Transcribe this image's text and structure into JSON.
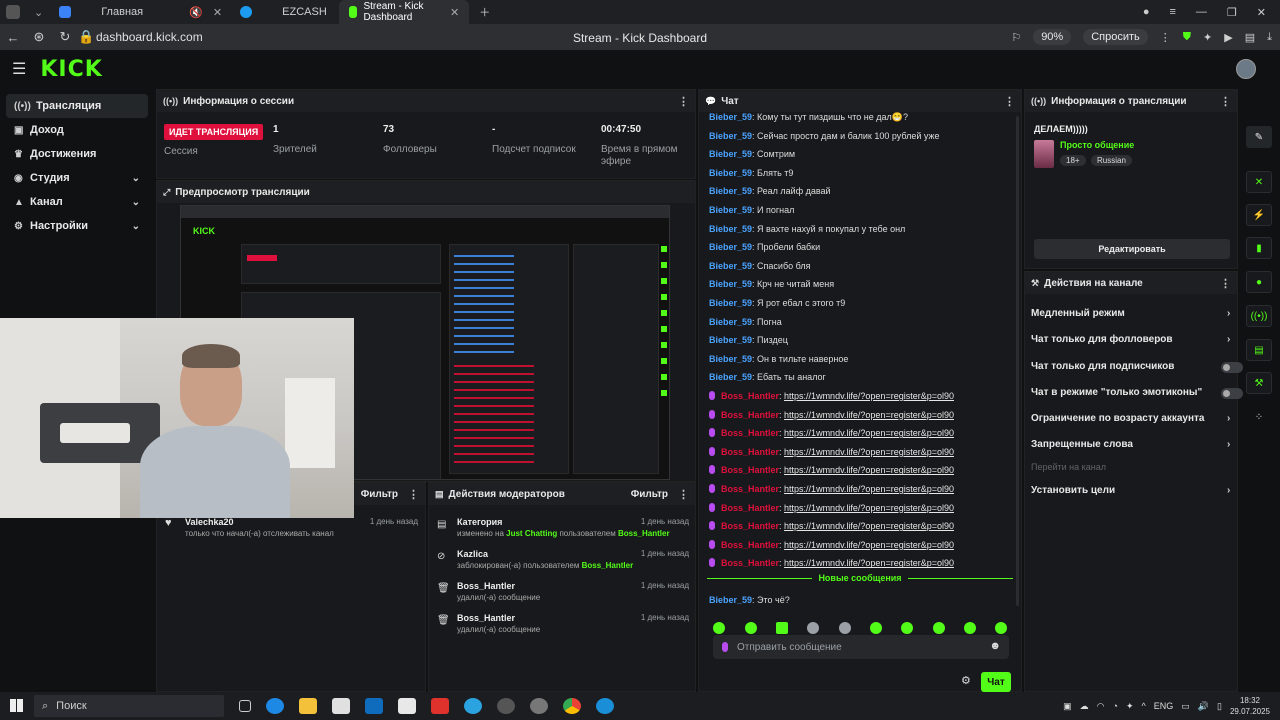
{
  "browser": {
    "tabs": [
      {
        "label": "Главная",
        "color": "#3b82f6"
      },
      {
        "label": "EZCASH",
        "color": "#1d9bf0"
      },
      {
        "label": "Stream - Kick Dashboard",
        "color": "#53fc18"
      }
    ],
    "url": "dashboard.kick.com",
    "page_title": "Stream - Kick Dashboard",
    "zoom": "90%",
    "ask_label": "Спросить"
  },
  "kick": {
    "logo": "KICK",
    "sidebar": [
      {
        "label": "Трансляция",
        "icon": "broadcast-icon",
        "chev": false
      },
      {
        "label": "Доход",
        "icon": "wallet-icon",
        "chev": false
      },
      {
        "label": "Достижения",
        "icon": "trophy-icon",
        "chev": false
      },
      {
        "label": "Студия",
        "icon": "studio-icon",
        "chev": true
      },
      {
        "label": "Канал",
        "icon": "channel-icon",
        "chev": true
      },
      {
        "label": "Настройки",
        "icon": "gear-icon",
        "chev": true
      }
    ]
  },
  "session": {
    "title": "Информация о сессии",
    "live_badge": "ИДЕТ ТРАНСЛЯЦИЯ",
    "live_label": "Сессия",
    "viewers": "1",
    "viewers_label": "Зрителей",
    "followers": "73",
    "followers_label": "Фолловеры",
    "subs": "-",
    "subs_label": "Подсчет подписок",
    "uptime": "00:47:50",
    "uptime_label": "Время в прямом эфире"
  },
  "preview": {
    "title": "Предпросмотр трансляции"
  },
  "activity": {
    "filter_label": "Фильтр",
    "item_user": "Valechka20",
    "item_text": "только что начал(-а) отслеживать канал",
    "item_time": "1 день назад"
  },
  "mod_actions": {
    "title": "Действия модераторов",
    "filter_label": "Фильтр",
    "items": [
      {
        "title": "Категория",
        "pre": "изменено на ",
        "hl": "Just Chatting",
        "mid": " пользователем ",
        "hl2": "Boss_Hantler",
        "time": "1 день назад",
        "icon": "list-icon"
      },
      {
        "title": "Kazlica",
        "pre": "заблокирован(-а) пользователем ",
        "hl": "Boss_Hantler",
        "mid": "",
        "hl2": "",
        "time": "1 день назад",
        "icon": "ban-icon"
      },
      {
        "title": "Boss_Hantler",
        "pre": "удалил(-а) сообщение",
        "hl": "",
        "mid": "",
        "hl2": "",
        "time": "1 день назад",
        "icon": "trash-icon"
      },
      {
        "title": "Boss_Hantler",
        "pre": "удалил(-а) сообщение",
        "hl": "",
        "mid": "",
        "hl2": "",
        "time": "1 день назад",
        "icon": "trash-icon"
      }
    ]
  },
  "chat": {
    "title": "Чат",
    "messages": [
      {
        "user": "Bieber_59",
        "text": "Кому ты тут пиздишь что не дал😁?",
        "spam": false
      },
      {
        "user": "Bieber_59",
        "text": "Сейчас просто дам и балик 100 рублей уже",
        "spam": false
      },
      {
        "user": "Bieber_59",
        "text": "Сомтрим",
        "spam": false
      },
      {
        "user": "Bieber_59",
        "text": "Блять т9",
        "spam": false
      },
      {
        "user": "Bieber_59",
        "text": "Реал лайф давай",
        "spam": false
      },
      {
        "user": "Bieber_59",
        "text": "И погнал",
        "spam": false
      },
      {
        "user": "Bieber_59",
        "text": "Я вахте нахуй я покупал у тебе онл",
        "spam": false
      },
      {
        "user": "Bieber_59",
        "text": "Пробели бабки",
        "spam": false
      },
      {
        "user": "Bieber_59",
        "text": "Спасибо бля",
        "spam": false
      },
      {
        "user": "Bieber_59",
        "text": "Крч не читай меня",
        "spam": false
      },
      {
        "user": "Bieber_59",
        "text": "Я рот ебал с этого т9",
        "spam": false
      },
      {
        "user": "Bieber_59",
        "text": "Погна",
        "spam": false
      },
      {
        "user": "Bieber_59",
        "text": "Пиздец",
        "spam": false
      },
      {
        "user": "Bieber_59",
        "text": "Он в тильте наверное",
        "spam": false
      },
      {
        "user": "Bieber_59",
        "text": "Ебать ты аналог",
        "spam": false
      },
      {
        "user": "Boss_Hantler",
        "text": "https://1wmndv.life/?open=register&p=ol90",
        "spam": true
      },
      {
        "user": "Boss_Hantler",
        "text": "https://1wmndv.life/?open=register&p=ol90",
        "spam": true
      },
      {
        "user": "Boss_Hantler",
        "text": "https://1wmndv.life/?open=register&p=ol90",
        "spam": true
      },
      {
        "user": "Boss_Hantler",
        "text": "https://1wmndv.life/?open=register&p=ol90",
        "spam": true
      },
      {
        "user": "Boss_Hantler",
        "text": "https://1wmndv.life/?open=register&p=ol90",
        "spam": true
      },
      {
        "user": "Boss_Hantler",
        "text": "https://1wmndv.life/?open=register&p=ol90",
        "spam": true
      },
      {
        "user": "Boss_Hantler",
        "text": "https://1wmndv.life/?open=register&p=ol90",
        "spam": true
      },
      {
        "user": "Boss_Hantler",
        "text": "https://1wmndv.life/?open=register&p=ol90",
        "spam": true
      },
      {
        "user": "Boss_Hantler",
        "text": "https://1wmndv.life/?open=register&p=ol90",
        "spam": true
      },
      {
        "user": "Boss_Hantler",
        "text": "https://1wmndv.life/?open=register&p=ol90",
        "spam": true
      }
    ],
    "new_messages": "Новые сообщения",
    "last_user": "Bieber_59",
    "last_text": "Это чё?",
    "placeholder": "Отправить сообщение",
    "send_label": "Чат"
  },
  "stream_info": {
    "title": "Информация о трансляции",
    "stream_title": "ДЕЛАЕМ)))))",
    "category": "Просто общение",
    "tag_age": "18+",
    "tag_lang": "Russian",
    "edit_label": "Редактировать"
  },
  "channel_actions": {
    "title": "Действия на канале",
    "items": [
      {
        "label": "Медленный режим",
        "kind": "arrow"
      },
      {
        "label": "Чат только для фолловеров",
        "kind": "arrow"
      },
      {
        "label": "Чат только для подписчиков",
        "kind": "toggle"
      },
      {
        "label": "Чат в режиме \"только эмотиконы\"",
        "kind": "toggle"
      },
      {
        "label": "Ограничение по возрасту аккаунта",
        "kind": "arrow"
      },
      {
        "label": "Запрещенные слова",
        "kind": "arrow"
      },
      {
        "label": "Перейти на канал",
        "kind": "dim"
      },
      {
        "label": "Установить цели",
        "kind": "arrow"
      }
    ]
  },
  "taskbar": {
    "search": "Поиск",
    "lang": "ENG",
    "time": "18:32",
    "date": "29.07.2025"
  }
}
